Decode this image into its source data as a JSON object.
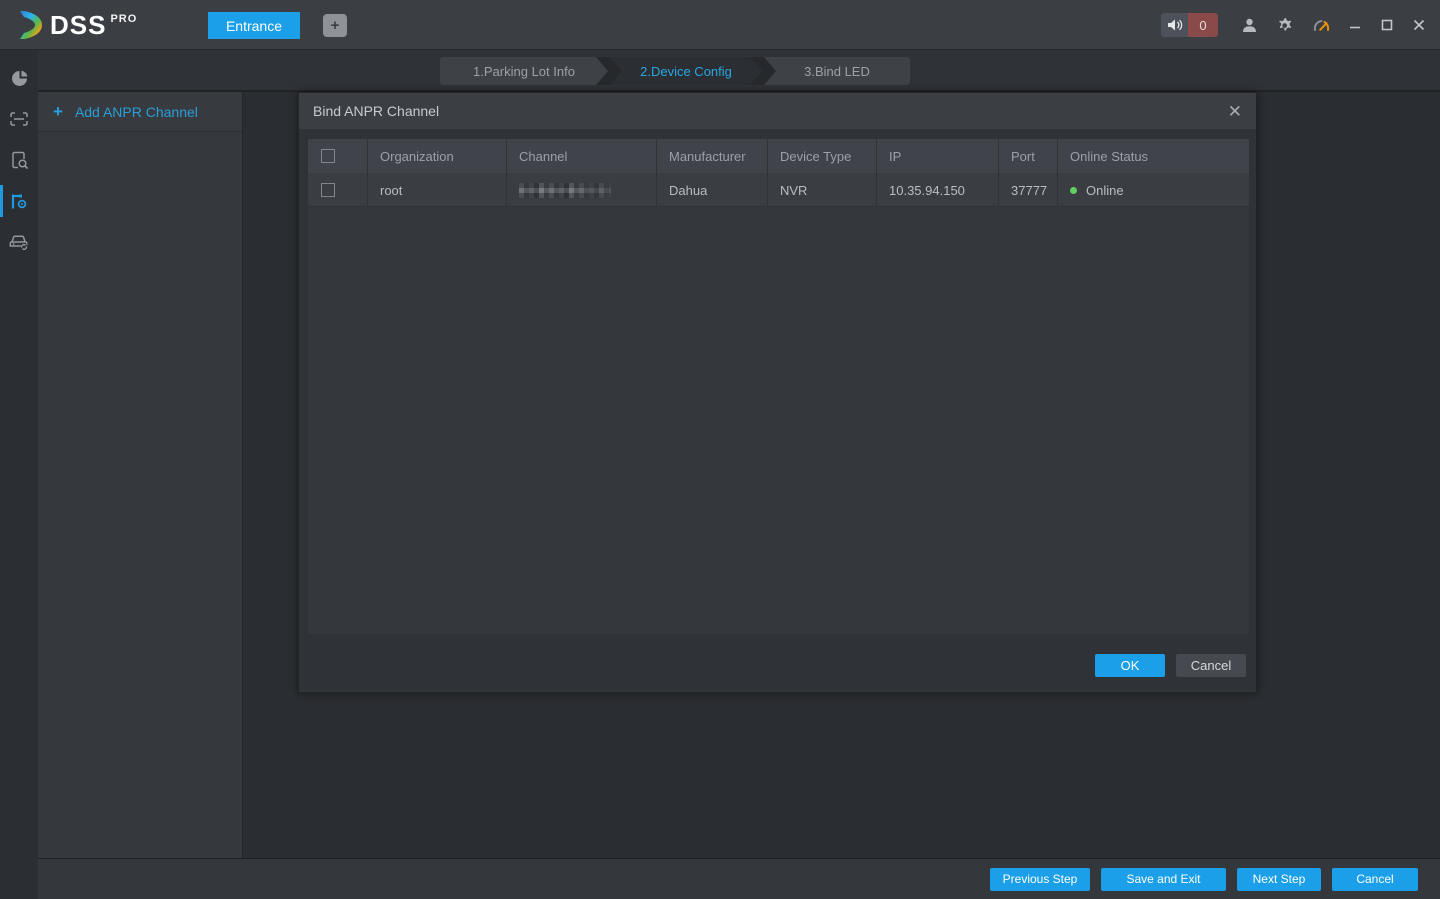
{
  "topbar": {
    "logo": {
      "name": "DSS",
      "pro": "PRO"
    },
    "entrance_tab": "Entrance",
    "add_tab_icon": "+",
    "alarm_count": "0"
  },
  "steps": [
    {
      "label": "1.Parking Lot Info",
      "active": false
    },
    {
      "label": "2.Device Config",
      "active": true
    },
    {
      "label": "3.Bind LED",
      "active": false
    }
  ],
  "sidebar": {
    "items": [
      {
        "icon": "pie-chart-icon"
      },
      {
        "icon": "plate-scan-icon"
      },
      {
        "icon": "record-search-icon"
      },
      {
        "icon": "barrier-gate-icon",
        "active": true
      },
      {
        "icon": "vehicle-sync-icon"
      }
    ]
  },
  "left_panel": {
    "plus_icon": "+",
    "add_channel_label": "Add ANPR Channel"
  },
  "dialog": {
    "title": "Bind ANPR Channel",
    "close_icon": "✕",
    "table": {
      "headers": {
        "organization": "Organization",
        "channel": "Channel",
        "manufacturer": "Manufacturer",
        "device_type": "Device Type",
        "ip": "IP",
        "port": "Port",
        "online_status": "Online Status"
      },
      "rows": [
        {
          "organization": "root",
          "channel_redacted": true,
          "manufacturer": "Dahua",
          "device_type": "NVR",
          "ip": "10.35.94.150",
          "port": "37777",
          "online_status": "Online"
        }
      ]
    },
    "ok_label": "OK",
    "cancel_label": "Cancel"
  },
  "footer": {
    "buttons": [
      "Previous Step",
      "Save and Exit",
      "Next Step",
      "Cancel"
    ]
  },
  "colors": {
    "accent_blue": "#1a9fe8",
    "active_step_text": "#2aa7e2",
    "online_green": "#5fd05f",
    "alarm_badge_red": "#8a4a4a"
  }
}
